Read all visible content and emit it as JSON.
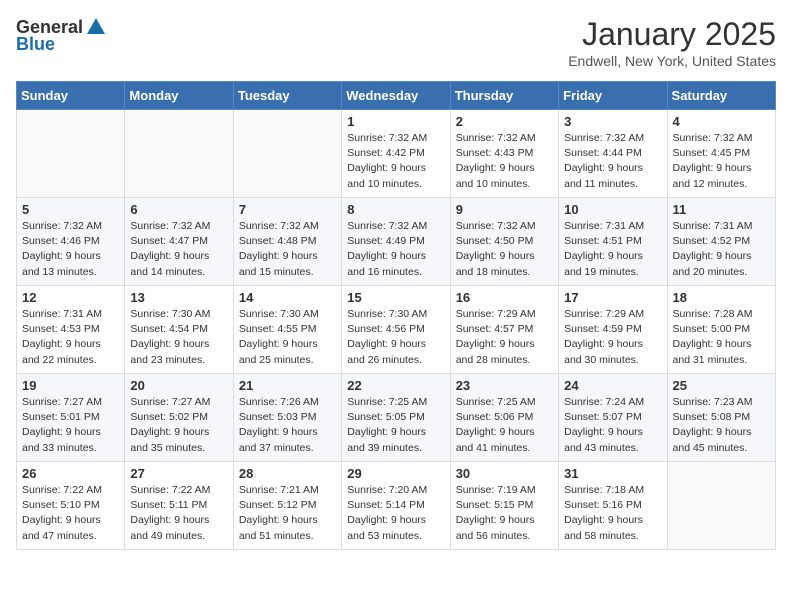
{
  "header": {
    "logo_general": "General",
    "logo_blue": "Blue",
    "month_title": "January 2025",
    "location": "Endwell, New York, United States"
  },
  "days_of_week": [
    "Sunday",
    "Monday",
    "Tuesday",
    "Wednesday",
    "Thursday",
    "Friday",
    "Saturday"
  ],
  "weeks": [
    [
      {
        "day": "",
        "info": ""
      },
      {
        "day": "",
        "info": ""
      },
      {
        "day": "",
        "info": ""
      },
      {
        "day": "1",
        "info": "Sunrise: 7:32 AM\nSunset: 4:42 PM\nDaylight: 9 hours and 10 minutes."
      },
      {
        "day": "2",
        "info": "Sunrise: 7:32 AM\nSunset: 4:43 PM\nDaylight: 9 hours and 10 minutes."
      },
      {
        "day": "3",
        "info": "Sunrise: 7:32 AM\nSunset: 4:44 PM\nDaylight: 9 hours and 11 minutes."
      },
      {
        "day": "4",
        "info": "Sunrise: 7:32 AM\nSunset: 4:45 PM\nDaylight: 9 hours and 12 minutes."
      }
    ],
    [
      {
        "day": "5",
        "info": "Sunrise: 7:32 AM\nSunset: 4:46 PM\nDaylight: 9 hours and 13 minutes."
      },
      {
        "day": "6",
        "info": "Sunrise: 7:32 AM\nSunset: 4:47 PM\nDaylight: 9 hours and 14 minutes."
      },
      {
        "day": "7",
        "info": "Sunrise: 7:32 AM\nSunset: 4:48 PM\nDaylight: 9 hours and 15 minutes."
      },
      {
        "day": "8",
        "info": "Sunrise: 7:32 AM\nSunset: 4:49 PM\nDaylight: 9 hours and 16 minutes."
      },
      {
        "day": "9",
        "info": "Sunrise: 7:32 AM\nSunset: 4:50 PM\nDaylight: 9 hours and 18 minutes."
      },
      {
        "day": "10",
        "info": "Sunrise: 7:31 AM\nSunset: 4:51 PM\nDaylight: 9 hours and 19 minutes."
      },
      {
        "day": "11",
        "info": "Sunrise: 7:31 AM\nSunset: 4:52 PM\nDaylight: 9 hours and 20 minutes."
      }
    ],
    [
      {
        "day": "12",
        "info": "Sunrise: 7:31 AM\nSunset: 4:53 PM\nDaylight: 9 hours and 22 minutes."
      },
      {
        "day": "13",
        "info": "Sunrise: 7:30 AM\nSunset: 4:54 PM\nDaylight: 9 hours and 23 minutes."
      },
      {
        "day": "14",
        "info": "Sunrise: 7:30 AM\nSunset: 4:55 PM\nDaylight: 9 hours and 25 minutes."
      },
      {
        "day": "15",
        "info": "Sunrise: 7:30 AM\nSunset: 4:56 PM\nDaylight: 9 hours and 26 minutes."
      },
      {
        "day": "16",
        "info": "Sunrise: 7:29 AM\nSunset: 4:57 PM\nDaylight: 9 hours and 28 minutes."
      },
      {
        "day": "17",
        "info": "Sunrise: 7:29 AM\nSunset: 4:59 PM\nDaylight: 9 hours and 30 minutes."
      },
      {
        "day": "18",
        "info": "Sunrise: 7:28 AM\nSunset: 5:00 PM\nDaylight: 9 hours and 31 minutes."
      }
    ],
    [
      {
        "day": "19",
        "info": "Sunrise: 7:27 AM\nSunset: 5:01 PM\nDaylight: 9 hours and 33 minutes."
      },
      {
        "day": "20",
        "info": "Sunrise: 7:27 AM\nSunset: 5:02 PM\nDaylight: 9 hours and 35 minutes."
      },
      {
        "day": "21",
        "info": "Sunrise: 7:26 AM\nSunset: 5:03 PM\nDaylight: 9 hours and 37 minutes."
      },
      {
        "day": "22",
        "info": "Sunrise: 7:25 AM\nSunset: 5:05 PM\nDaylight: 9 hours and 39 minutes."
      },
      {
        "day": "23",
        "info": "Sunrise: 7:25 AM\nSunset: 5:06 PM\nDaylight: 9 hours and 41 minutes."
      },
      {
        "day": "24",
        "info": "Sunrise: 7:24 AM\nSunset: 5:07 PM\nDaylight: 9 hours and 43 minutes."
      },
      {
        "day": "25",
        "info": "Sunrise: 7:23 AM\nSunset: 5:08 PM\nDaylight: 9 hours and 45 minutes."
      }
    ],
    [
      {
        "day": "26",
        "info": "Sunrise: 7:22 AM\nSunset: 5:10 PM\nDaylight: 9 hours and 47 minutes."
      },
      {
        "day": "27",
        "info": "Sunrise: 7:22 AM\nSunset: 5:11 PM\nDaylight: 9 hours and 49 minutes."
      },
      {
        "day": "28",
        "info": "Sunrise: 7:21 AM\nSunset: 5:12 PM\nDaylight: 9 hours and 51 minutes."
      },
      {
        "day": "29",
        "info": "Sunrise: 7:20 AM\nSunset: 5:14 PM\nDaylight: 9 hours and 53 minutes."
      },
      {
        "day": "30",
        "info": "Sunrise: 7:19 AM\nSunset: 5:15 PM\nDaylight: 9 hours and 56 minutes."
      },
      {
        "day": "31",
        "info": "Sunrise: 7:18 AM\nSunset: 5:16 PM\nDaylight: 9 hours and 58 minutes."
      },
      {
        "day": "",
        "info": ""
      }
    ]
  ]
}
